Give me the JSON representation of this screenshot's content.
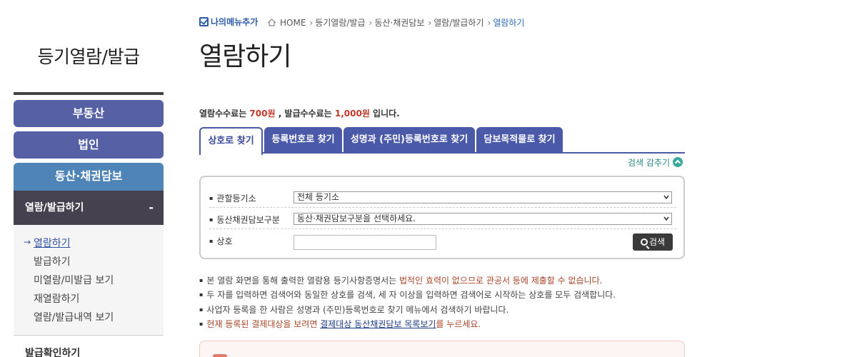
{
  "sidebar": {
    "title": "등기열람/발급",
    "nav": [
      "부동산",
      "법인",
      "동산·채권담보"
    ],
    "open_section": {
      "label": "열람/발급하기",
      "toggle": "-"
    },
    "sub_items": [
      "열람하기",
      "발급하기",
      "미열람/미발급 보기",
      "재열람하기",
      "열람/발급내역 보기"
    ],
    "active_sub": "열람하기",
    "next_section": "발급확인하기"
  },
  "breadcrumb": {
    "my_menu": "나의메뉴추가",
    "items": [
      "HOME",
      "등기열람/발급",
      "동산·채권담보",
      "열람/발급하기"
    ],
    "current": "열람하기"
  },
  "page_title": "열람하기",
  "fee": {
    "part1": "열람수수료는 ",
    "view_fee": "700원",
    "part2": " , 발급수수료는 ",
    "issue_fee": "1,000원",
    "part3": " 입니다."
  },
  "tabs": [
    "상호로 찾기",
    "등록번호로 찾기",
    "성명과 (주민)등록번호로 찾기",
    "담보목적물로 찾기"
  ],
  "active_tab": "상호로 찾기",
  "hide_search": "검색 감추기",
  "form": {
    "registry_label": "관할등기소",
    "registry_value": "전체 등기소",
    "type_label": "동산채권담보구분",
    "type_value": "동산·채권담보구분을 선택하세요.",
    "name_label": "상호",
    "name_value": "",
    "search_button": "검색"
  },
  "notes": {
    "n1_a": "본 열람 화면을 통해 출력한 열람용 등기사항증명서는 ",
    "n1_b": "법적인 효력이 없으므로 관공서 등에 제출할 수 없습니다.",
    "n2": "두 자를 입력하면 검색어와 동일한 상호를 검색, 세 자 이상을 입력하면 검색어로 시작하는 상호를 모두 검색합니다.",
    "n3": "사업자 등록을 한 사람은 성명과 (주민)등록번호로 찾기 메뉴에서 검색하기 바랍니다.",
    "n4_a": "현재 등록된 결제대상을 보려면 ",
    "n4_link": "결제대상 동산채권담보 목록보기",
    "n4_b": "를 누르세요."
  },
  "colors": {
    "nav_blue": "#5561a4",
    "nav_teal": "#4e84b8",
    "nav_dark": "#46414f",
    "fee_red": "#c0392b"
  }
}
